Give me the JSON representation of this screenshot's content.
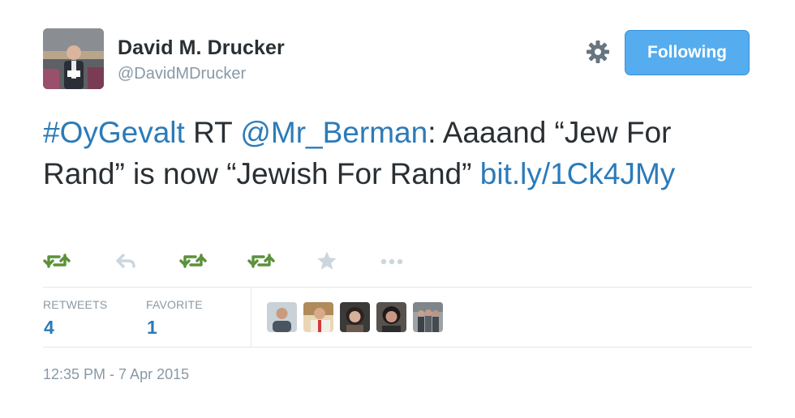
{
  "author": {
    "display_name": "David M. Drucker",
    "handle": "@DavidMDrucker",
    "avatar_icon": "profile-photo"
  },
  "header": {
    "settings_icon": "gear-icon",
    "follow_button_label": "Following",
    "follow_button_color": "#55acee"
  },
  "tweet": {
    "parts": [
      {
        "text": "#OyGevalt",
        "kind": "hashtag"
      },
      {
        "text": " RT ",
        "kind": "plain"
      },
      {
        "text": "@Mr_Berman",
        "kind": "mention"
      },
      {
        "text": ": Aaaand “Jew For Rand” is now “Jewish For Rand” ",
        "kind": "plain"
      },
      {
        "text": "bit.ly/1Ck4JMy",
        "kind": "link"
      }
    ],
    "link_color": "#2b7bb9",
    "text_color": "#292f33"
  },
  "actions": [
    {
      "icon": "retweet-icon",
      "color": "#5c913b"
    },
    {
      "icon": "reply-icon",
      "color": "#ccd6dd"
    },
    {
      "icon": "retweet-icon",
      "color": "#5c913b"
    },
    {
      "icon": "retweet-icon",
      "color": "#5c913b"
    },
    {
      "icon": "favorite-star-icon",
      "color": "#ccd6dd"
    },
    {
      "icon": "more-options-icon",
      "color": "#ccd6dd"
    }
  ],
  "stats": {
    "retweets_label": "RETWEETS",
    "retweets_count": "4",
    "favorites_label": "FAVORITE",
    "favorites_count": "1"
  },
  "engaged_users": [
    {
      "icon": "user-avatar-1"
    },
    {
      "icon": "user-avatar-2"
    },
    {
      "icon": "user-avatar-3"
    },
    {
      "icon": "user-avatar-4"
    },
    {
      "icon": "user-avatar-5"
    }
  ],
  "timestamp": "12:35 PM - 7 Apr 2015"
}
